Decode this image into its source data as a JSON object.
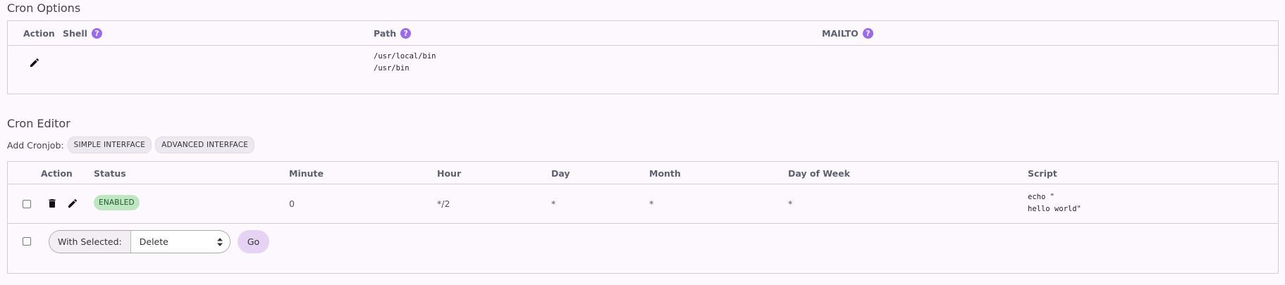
{
  "cron_options": {
    "title": "Cron Options",
    "headers": {
      "action": "Action",
      "shell": "Shell",
      "path": "Path",
      "mailto": "MAILTO"
    },
    "help_glyph": "?",
    "row": {
      "path_lines": [
        "/usr/local/bin",
        "/usr/bin"
      ]
    }
  },
  "cron_editor": {
    "title": "Cron Editor",
    "add_label": "Add Cronjob:",
    "simple_button": "SIMPLE INTERFACE",
    "advanced_button": "ADVANCED INTERFACE",
    "headers": {
      "action": "Action",
      "status": "Status",
      "minute": "Minute",
      "hour": "Hour",
      "day": "Day",
      "month": "Month",
      "day_of_week": "Day of Week",
      "script": "Script"
    },
    "row": {
      "status": "ENABLED",
      "minute": "0",
      "hour": "*/2",
      "day": "*",
      "month": "*",
      "day_of_week": "*",
      "script_lines": [
        "echo \"",
        "hello world\""
      ]
    },
    "bulk": {
      "label": "With Selected:",
      "selected_option": "Delete",
      "go_label": "Go"
    }
  },
  "colors": {
    "background": "#fdf8fd",
    "help_icon": "#9a6af0",
    "status_enabled_bg": "#bfe6c3",
    "go_button_bg": "#e6d2f2"
  },
  "icons": [
    "pencil-icon",
    "trash-icon",
    "help-icon",
    "select-arrows-icon"
  ]
}
